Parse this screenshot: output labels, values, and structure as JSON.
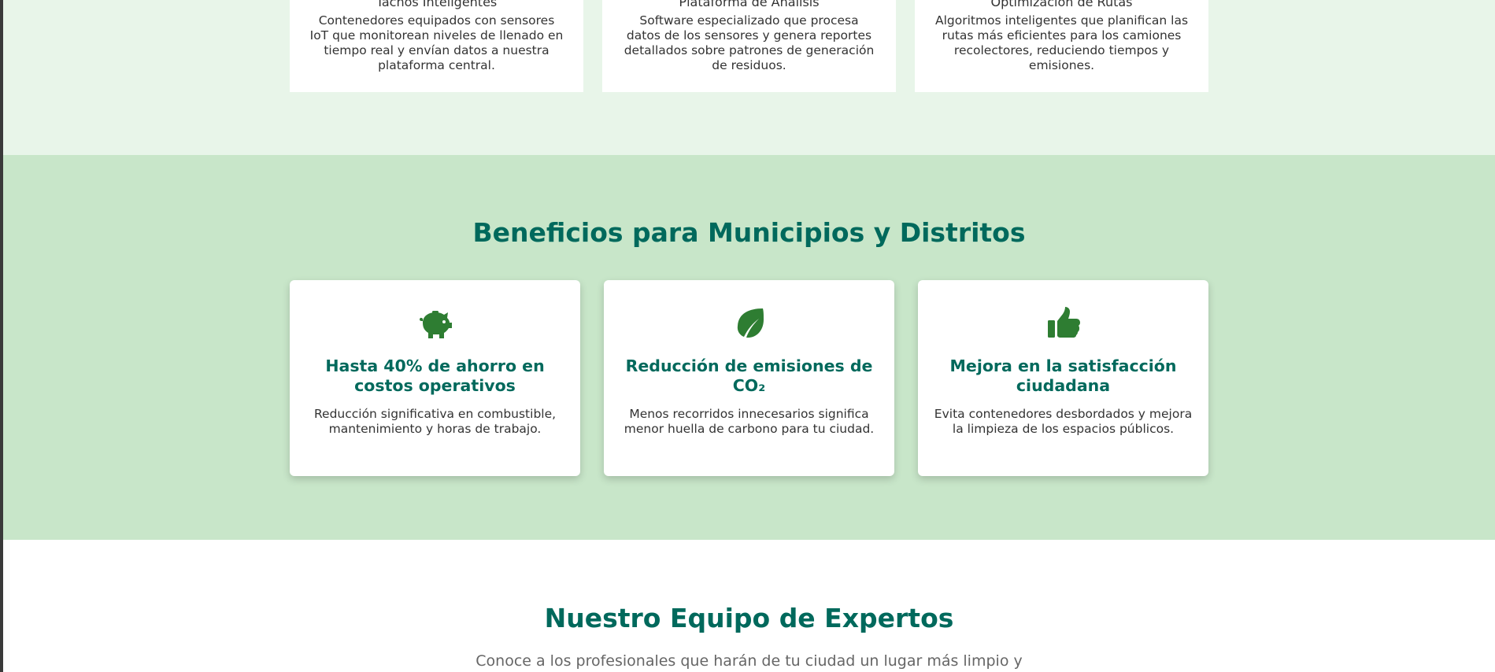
{
  "solutions": [
    {
      "title": "Tachos Inteligentes",
      "description": "Contenedores equipados con sensores IoT que monitorean niveles de llenado en tiempo real y envían datos a nuestra plataforma central."
    },
    {
      "title": "Plataforma de Análisis",
      "description": "Software especializado que procesa datos de los sensores y genera reportes detallados sobre patrones de generación de residuos."
    },
    {
      "title": "Optimización de Rutas",
      "description": "Algoritmos inteligentes que planifican las rutas más eficientes para los camiones recolectores, reduciendo tiempos y emisiones."
    }
  ],
  "benefits": {
    "title": "Beneficios para Municipios y Distritos",
    "items": [
      {
        "icon": "piggy-bank-icon",
        "title": "Hasta 40% de ahorro en costos operativos",
        "description": "Reducción significativa en combustible, mantenimiento y horas de trabajo."
      },
      {
        "icon": "leaf-icon",
        "title": "Reducción de emisiones de CO₂",
        "description": "Menos recorridos innecesarios significa menor huella de carbono para tu ciudad."
      },
      {
        "icon": "thumbs-up-icon",
        "title": "Mejora en la satisfacción ciudadana",
        "description": "Evita contenedores desbordados y mejora la limpieza de los espacios públicos."
      }
    ]
  },
  "team": {
    "title": "Nuestro Equipo de Expertos",
    "subtitle": "Conoce a los profesionales que harán de tu ciudad un lugar más limpio y"
  },
  "colors": {
    "primary_text": "#00695c",
    "icon_green": "#2e7d32",
    "light_section": "#e8f5e9",
    "benefits_section": "#c8e6c9"
  }
}
